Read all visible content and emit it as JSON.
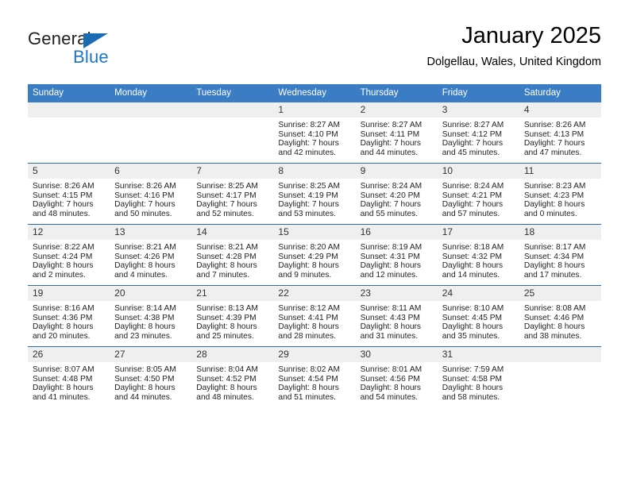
{
  "logo": {
    "word_top": "General",
    "word_bottom": "Blue",
    "triangle_color": "#1b6cb5",
    "blue_color": "#1b76c8"
  },
  "header": {
    "title": "January 2025",
    "subtitle": "Dolgellau, Wales, United Kingdom"
  },
  "theme": {
    "header_bg": "#3b7dc4",
    "row_divider": "#2c6ca8",
    "date_band": "#efefef"
  },
  "weekday_headers": [
    "Sunday",
    "Monday",
    "Tuesday",
    "Wednesday",
    "Thursday",
    "Friday",
    "Saturday"
  ],
  "weeks": [
    [
      {
        "date": "",
        "lines": []
      },
      {
        "date": "",
        "lines": []
      },
      {
        "date": "",
        "lines": []
      },
      {
        "date": "1",
        "lines": [
          "Sunrise: 8:27 AM",
          "Sunset: 4:10 PM",
          "Daylight: 7 hours",
          "and 42 minutes."
        ]
      },
      {
        "date": "2",
        "lines": [
          "Sunrise: 8:27 AM",
          "Sunset: 4:11 PM",
          "Daylight: 7 hours",
          "and 44 minutes."
        ]
      },
      {
        "date": "3",
        "lines": [
          "Sunrise: 8:27 AM",
          "Sunset: 4:12 PM",
          "Daylight: 7 hours",
          "and 45 minutes."
        ]
      },
      {
        "date": "4",
        "lines": [
          "Sunrise: 8:26 AM",
          "Sunset: 4:13 PM",
          "Daylight: 7 hours",
          "and 47 minutes."
        ]
      }
    ],
    [
      {
        "date": "5",
        "lines": [
          "Sunrise: 8:26 AM",
          "Sunset: 4:15 PM",
          "Daylight: 7 hours",
          "and 48 minutes."
        ]
      },
      {
        "date": "6",
        "lines": [
          "Sunrise: 8:26 AM",
          "Sunset: 4:16 PM",
          "Daylight: 7 hours",
          "and 50 minutes."
        ]
      },
      {
        "date": "7",
        "lines": [
          "Sunrise: 8:25 AM",
          "Sunset: 4:17 PM",
          "Daylight: 7 hours",
          "and 52 minutes."
        ]
      },
      {
        "date": "8",
        "lines": [
          "Sunrise: 8:25 AM",
          "Sunset: 4:19 PM",
          "Daylight: 7 hours",
          "and 53 minutes."
        ]
      },
      {
        "date": "9",
        "lines": [
          "Sunrise: 8:24 AM",
          "Sunset: 4:20 PM",
          "Daylight: 7 hours",
          "and 55 minutes."
        ]
      },
      {
        "date": "10",
        "lines": [
          "Sunrise: 8:24 AM",
          "Sunset: 4:21 PM",
          "Daylight: 7 hours",
          "and 57 minutes."
        ]
      },
      {
        "date": "11",
        "lines": [
          "Sunrise: 8:23 AM",
          "Sunset: 4:23 PM",
          "Daylight: 8 hours",
          "and 0 minutes."
        ]
      }
    ],
    [
      {
        "date": "12",
        "lines": [
          "Sunrise: 8:22 AM",
          "Sunset: 4:24 PM",
          "Daylight: 8 hours",
          "and 2 minutes."
        ]
      },
      {
        "date": "13",
        "lines": [
          "Sunrise: 8:21 AM",
          "Sunset: 4:26 PM",
          "Daylight: 8 hours",
          "and 4 minutes."
        ]
      },
      {
        "date": "14",
        "lines": [
          "Sunrise: 8:21 AM",
          "Sunset: 4:28 PM",
          "Daylight: 8 hours",
          "and 7 minutes."
        ]
      },
      {
        "date": "15",
        "lines": [
          "Sunrise: 8:20 AM",
          "Sunset: 4:29 PM",
          "Daylight: 8 hours",
          "and 9 minutes."
        ]
      },
      {
        "date": "16",
        "lines": [
          "Sunrise: 8:19 AM",
          "Sunset: 4:31 PM",
          "Daylight: 8 hours",
          "and 12 minutes."
        ]
      },
      {
        "date": "17",
        "lines": [
          "Sunrise: 8:18 AM",
          "Sunset: 4:32 PM",
          "Daylight: 8 hours",
          "and 14 minutes."
        ]
      },
      {
        "date": "18",
        "lines": [
          "Sunrise: 8:17 AM",
          "Sunset: 4:34 PM",
          "Daylight: 8 hours",
          "and 17 minutes."
        ]
      }
    ],
    [
      {
        "date": "19",
        "lines": [
          "Sunrise: 8:16 AM",
          "Sunset: 4:36 PM",
          "Daylight: 8 hours",
          "and 20 minutes."
        ]
      },
      {
        "date": "20",
        "lines": [
          "Sunrise: 8:14 AM",
          "Sunset: 4:38 PM",
          "Daylight: 8 hours",
          "and 23 minutes."
        ]
      },
      {
        "date": "21",
        "lines": [
          "Sunrise: 8:13 AM",
          "Sunset: 4:39 PM",
          "Daylight: 8 hours",
          "and 25 minutes."
        ]
      },
      {
        "date": "22",
        "lines": [
          "Sunrise: 8:12 AM",
          "Sunset: 4:41 PM",
          "Daylight: 8 hours",
          "and 28 minutes."
        ]
      },
      {
        "date": "23",
        "lines": [
          "Sunrise: 8:11 AM",
          "Sunset: 4:43 PM",
          "Daylight: 8 hours",
          "and 31 minutes."
        ]
      },
      {
        "date": "24",
        "lines": [
          "Sunrise: 8:10 AM",
          "Sunset: 4:45 PM",
          "Daylight: 8 hours",
          "and 35 minutes."
        ]
      },
      {
        "date": "25",
        "lines": [
          "Sunrise: 8:08 AM",
          "Sunset: 4:46 PM",
          "Daylight: 8 hours",
          "and 38 minutes."
        ]
      }
    ],
    [
      {
        "date": "26",
        "lines": [
          "Sunrise: 8:07 AM",
          "Sunset: 4:48 PM",
          "Daylight: 8 hours",
          "and 41 minutes."
        ]
      },
      {
        "date": "27",
        "lines": [
          "Sunrise: 8:05 AM",
          "Sunset: 4:50 PM",
          "Daylight: 8 hours",
          "and 44 minutes."
        ]
      },
      {
        "date": "28",
        "lines": [
          "Sunrise: 8:04 AM",
          "Sunset: 4:52 PM",
          "Daylight: 8 hours",
          "and 48 minutes."
        ]
      },
      {
        "date": "29",
        "lines": [
          "Sunrise: 8:02 AM",
          "Sunset: 4:54 PM",
          "Daylight: 8 hours",
          "and 51 minutes."
        ]
      },
      {
        "date": "30",
        "lines": [
          "Sunrise: 8:01 AM",
          "Sunset: 4:56 PM",
          "Daylight: 8 hours",
          "and 54 minutes."
        ]
      },
      {
        "date": "31",
        "lines": [
          "Sunrise: 7:59 AM",
          "Sunset: 4:58 PM",
          "Daylight: 8 hours",
          "and 58 minutes."
        ]
      },
      {
        "date": "",
        "lines": []
      }
    ]
  ]
}
